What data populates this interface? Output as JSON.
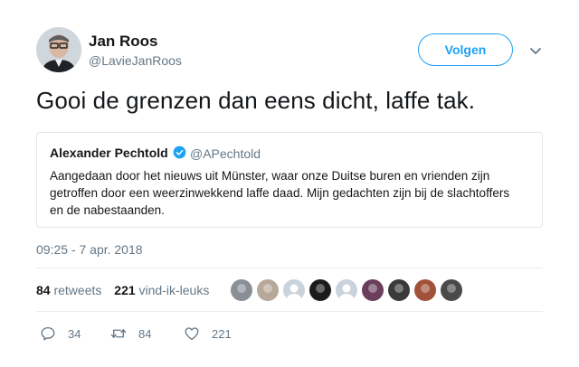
{
  "author": {
    "name": "Jan Roos",
    "handle": "@LavieJanRoos"
  },
  "follow_label": "Volgen",
  "tweet_text": "Gooi de grenzen dan eens dicht, laffe tak.",
  "quoted": {
    "name": "Alexander Pechtold",
    "handle": "@APechtold",
    "lines": [
      "Aangedaan door het nieuws uit Münster, waar onze Duitse buren en vrienden zijn",
      "getroffen door een weerzinwekkend laffe daad. Mijn gedachten zijn bij de slachtoffers",
      "en de nabestaanden."
    ]
  },
  "timestamp": "09:25 - 7 apr. 2018",
  "stats": {
    "retweets_count": "84",
    "retweets_label": "retweets",
    "likes_count": "221",
    "likes_label": "vind-ik-leuks"
  },
  "actions": {
    "replies": "34",
    "retweets": "84",
    "likes": "221"
  },
  "colors": {
    "accent": "#1da1f2",
    "secondary_text": "#657786",
    "verified": "#1da1f2"
  },
  "liker_avatars": [
    {
      "icon": "person-photo-avatar",
      "color": "#8a8f96"
    },
    {
      "icon": "person-photo-avatar",
      "color": "#b7a89a"
    },
    {
      "icon": "default-avatar",
      "color": "#c9d3dc"
    },
    {
      "icon": "dog-photo-avatar",
      "color": "#1b1b1b"
    },
    {
      "icon": "default-avatar",
      "color": "#c9d3dc"
    },
    {
      "icon": "person-photo-avatar",
      "color": "#6b3f5c"
    },
    {
      "icon": "group-photo-avatar",
      "color": "#3a3a3a"
    },
    {
      "icon": "person-photo-avatar",
      "color": "#a0523a"
    },
    {
      "icon": "dark-photo-avatar",
      "color": "#4a4a4a"
    }
  ]
}
